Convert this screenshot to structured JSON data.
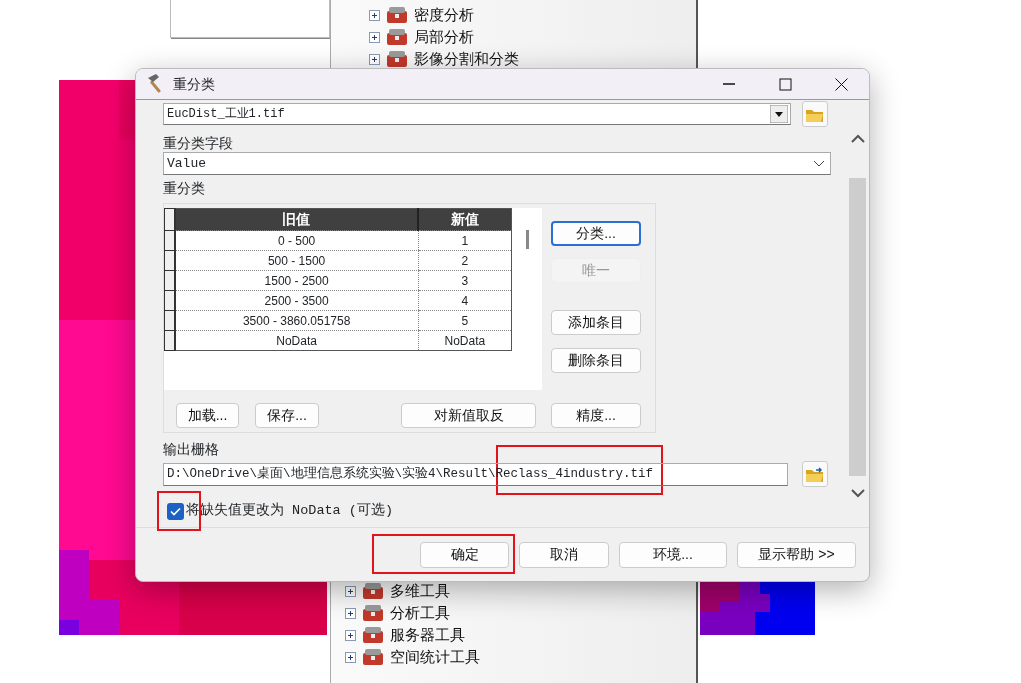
{
  "toolbox_tree": {
    "top_items": [
      {
        "label": "密度分析",
        "expanded": false
      },
      {
        "label": "局部分析",
        "expanded": false
      },
      {
        "label": "影像分割和分类",
        "expanded": false
      }
    ],
    "bottom_items": [
      {
        "label": "多维工具",
        "expanded": false
      },
      {
        "label": "分析工具",
        "expanded": false
      },
      {
        "label": "服务器工具",
        "expanded": false
      },
      {
        "label": "空间统计工具",
        "expanded": false
      }
    ]
  },
  "window": {
    "title": "重分类"
  },
  "input_raster": {
    "value": "EucDist_工业1.tif"
  },
  "reclass_field": {
    "label": "重分类字段",
    "value": "Value"
  },
  "reclassification": {
    "label": "重分类",
    "columns": [
      "旧值",
      "新值"
    ],
    "rows": [
      {
        "old": "0 - 500",
        "new": "1"
      },
      {
        "old": "500 - 1500",
        "new": "2"
      },
      {
        "old": "1500 - 2500",
        "new": "3"
      },
      {
        "old": "2500 - 3500",
        "new": "4"
      },
      {
        "old": "3500 - 3860.051758",
        "new": "5"
      },
      {
        "old": "NoData",
        "new": "NoData"
      }
    ],
    "side_buttons": [
      {
        "label": "分类...",
        "disabled": false,
        "focused": true
      },
      {
        "label": "唯一",
        "disabled": true,
        "focused": false
      },
      {
        "label": "添加条目",
        "disabled": false,
        "focused": false
      },
      {
        "label": "删除条目",
        "disabled": false,
        "focused": false
      }
    ],
    "bottom_buttons": [
      {
        "label": "加载..."
      },
      {
        "label": "保存..."
      },
      {
        "label": "对新值取反"
      },
      {
        "label": "精度..."
      }
    ]
  },
  "output_raster": {
    "label": "输出栅格",
    "value": "D:\\OneDrive\\桌面\\地理信息系统实验\\实验4\\Result\\Reclass_4industry.tif",
    "highlighted": true
  },
  "nodata_option": {
    "label": "将缺失值更改为 NoData (可选)",
    "checked": true,
    "highlighted": true
  },
  "footer_buttons": [
    {
      "label": "确定",
      "highlighted": true
    },
    {
      "label": "取消",
      "highlighted": false
    },
    {
      "label": "环境...",
      "highlighted": false
    },
    {
      "label": "显示帮助 >>",
      "highlighted": false
    }
  ]
}
